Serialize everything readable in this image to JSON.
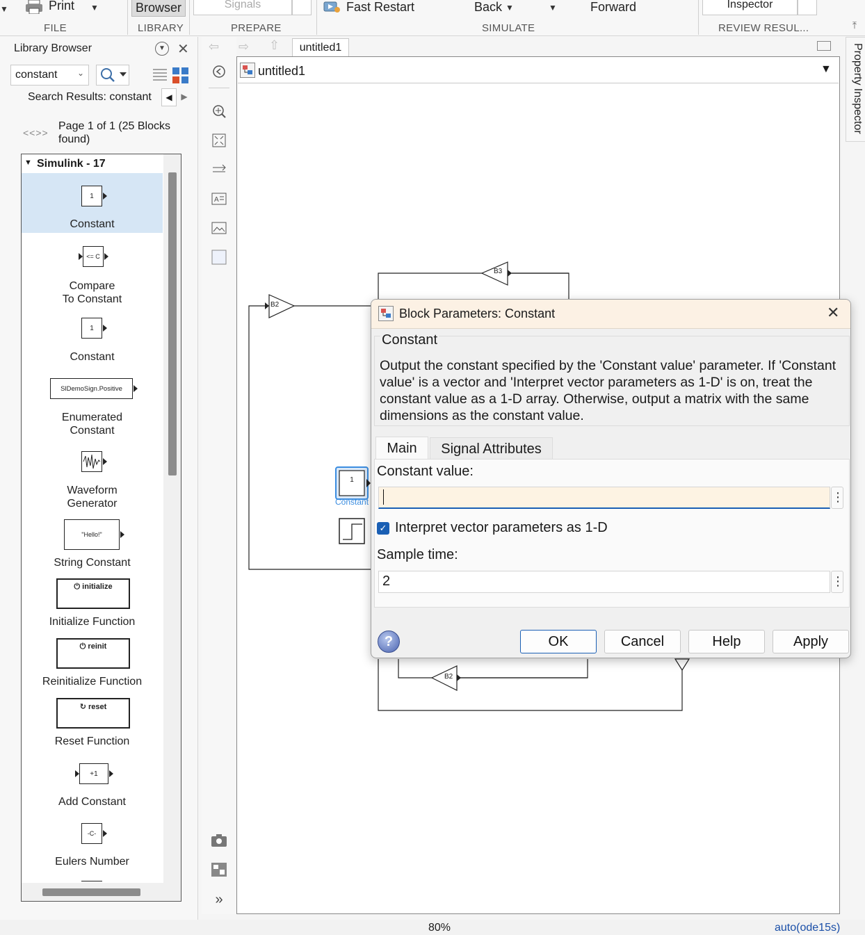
{
  "toolstrip": {
    "print_label": "Print",
    "browser_label": "Browser",
    "signals_label": "Signals",
    "fast_restart_label": "Fast Restart",
    "back_label": "Back",
    "forward_label": "Forward",
    "inspector_label": "Inspector",
    "sections": [
      "FILE",
      "LIBRARY",
      "PREPARE",
      "SIMULATE",
      "REVIEW RESUL..."
    ]
  },
  "library": {
    "title": "Library Browser",
    "search_value": "constant",
    "results_label": "Search Results: constant",
    "page_nav": "<<>>",
    "page_info": "Page 1 of 1 (25 Blocks found)",
    "group_label": "Simulink - 17",
    "items": [
      {
        "label": "Constant",
        "glyph": "1"
      },
      {
        "label": "Compare\nTo Constant",
        "glyph": "<= C"
      },
      {
        "label": "Constant",
        "glyph": "1"
      },
      {
        "label": "Enumerated\nConstant",
        "glyph": "SlDemoSign.Positive"
      },
      {
        "label": "Waveform\nGenerator",
        "glyph": ""
      },
      {
        "label": "String Constant",
        "glyph": "\"Hello!\""
      },
      {
        "label": "Initialize Function",
        "glyph": "initialize"
      },
      {
        "label": "Reinitialize Function",
        "glyph": "reinit"
      },
      {
        "label": "Reset Function",
        "glyph": "reset"
      },
      {
        "label": "Add Constant",
        "glyph": "+1"
      },
      {
        "label": "Eulers Number",
        "glyph": "-C-"
      }
    ]
  },
  "canvas": {
    "tab_label": "untitled1",
    "address": "untitled1",
    "blocks": {
      "b3_label": "B3",
      "b2_left_label": "B2",
      "b2_bottom_label": "B2",
      "constant_value": "1",
      "constant_label": "Constant"
    }
  },
  "dialog": {
    "title": "Block Parameters: Constant",
    "block_name": "Constant",
    "description": "Output the constant specified by the 'Constant value' parameter. If 'Constant value' is a vector and 'Interpret vector parameters as 1-D' is on, treat the constant value as a 1-D array. Otherwise, output a matrix with the same dimensions as the constant value.",
    "tabs": [
      "Main",
      "Signal Attributes"
    ],
    "constant_value_label": "Constant value:",
    "constant_value": "",
    "interpret_label": "Interpret vector parameters as 1-D",
    "interpret_checked": true,
    "sample_time_label": "Sample time:",
    "sample_time_value": "2",
    "buttons": {
      "ok": "OK",
      "cancel": "Cancel",
      "help": "Help",
      "apply": "Apply"
    }
  },
  "property_inspector_label": "Property Inspector",
  "status": {
    "zoom": "80%",
    "solver": "auto(ode15s)"
  }
}
